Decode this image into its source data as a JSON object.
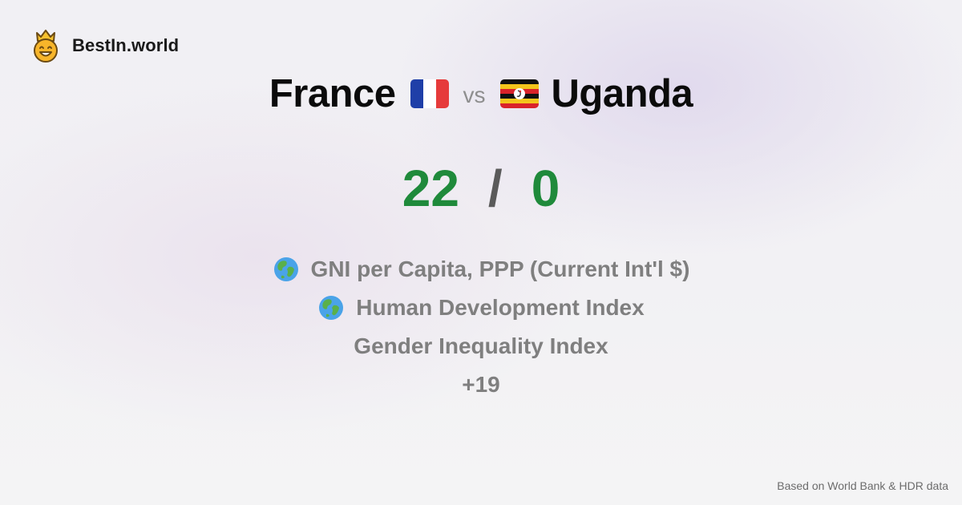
{
  "brand": {
    "name": "BestIn.world",
    "logo_icon": "crown-smiley-icon"
  },
  "comparison": {
    "country_a": {
      "name": "France",
      "flag_icon": "france-flag-icon"
    },
    "separator": "vs",
    "country_b": {
      "name": "Uganda",
      "flag_icon": "uganda-flag-icon"
    }
  },
  "score": {
    "country_a": "22",
    "divider": "/",
    "country_b": "0",
    "color": "#1f8a3b"
  },
  "metrics": [
    {
      "label": "GNI per Capita, PPP (Current Int'l $)",
      "icon": "globe-icon"
    },
    {
      "label": "Human Development Index",
      "icon": "globe-icon"
    },
    {
      "label": "Gender Inequality Index",
      "icon": ""
    }
  ],
  "more_metrics": "+19",
  "footer": {
    "source_note": "Based on World Bank & HDR data"
  }
}
